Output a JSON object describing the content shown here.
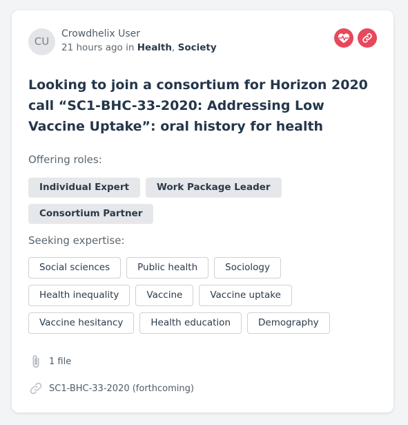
{
  "post": {
    "avatar_initials": "CU",
    "author": "Crowdhelix User",
    "time": "21 hours ago",
    "in_word": "in",
    "categories": [
      "Health",
      "Society"
    ],
    "title": "Looking to join a consortium for Horizon 2020 call “SC1-BHC-33-2020: Addressing Low Vaccine Uptake”: oral history for health"
  },
  "actions": {
    "health_icon": "heart-pulse-icon",
    "link_icon": "link-icon",
    "accent_color": "#e8485c"
  },
  "offering": {
    "label": "Offering roles:",
    "roles": [
      "Individual Expert",
      "Work Package Leader",
      "Consortium Partner"
    ]
  },
  "seeking": {
    "label": "Seeking expertise:",
    "tags": [
      "Social sciences",
      "Public health",
      "Sociology",
      "Health inequality",
      "Vaccine",
      "Vaccine uptake",
      "Vaccine hesitancy",
      "Health education",
      "Demography"
    ]
  },
  "footer": {
    "files": "1 file",
    "link_text": "SC1-BHC-33-2020 (forthcoming)"
  }
}
